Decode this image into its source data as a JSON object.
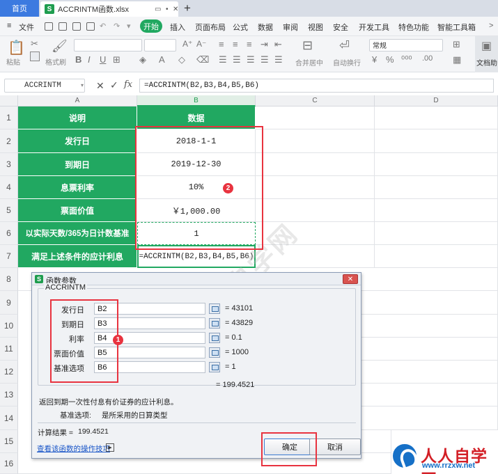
{
  "titlebar": {
    "home_tab": "首页",
    "doc_tab_title": "ACCRINTM函数.xlsx",
    "add_tab": "+"
  },
  "menu": {
    "file": "文件",
    "items": [
      "开始",
      "插入",
      "页面布局",
      "公式",
      "数据",
      "审阅",
      "视图",
      "安全",
      "开发工具",
      "特色功能",
      "智能工具箱"
    ]
  },
  "ribbon": {
    "paste": "粘贴",
    "format_painter": "格式刷",
    "merge_center": "合并居中",
    "auto_wrap": "自动换行",
    "number_format": "常规",
    "doc_helper": "文档助"
  },
  "formula_bar": {
    "name_box": "ACCRINTM",
    "fx": "fx",
    "formula": "=ACCRINTM(B2,B3,B4,B5,B6)"
  },
  "grid": {
    "columns": [
      "A",
      "B",
      "C",
      "D"
    ],
    "rows": [
      "1",
      "2",
      "3",
      "4",
      "5",
      "6",
      "7",
      "8",
      "9",
      "10",
      "11",
      "12",
      "13",
      "14",
      "15",
      "16"
    ],
    "data": [
      {
        "label": "说明",
        "value": "数据"
      },
      {
        "label": "发行日",
        "value": "2018-1-1"
      },
      {
        "label": "到期日",
        "value": "2019-12-30"
      },
      {
        "label": "息票利率",
        "value": "10%"
      },
      {
        "label": "票面价值",
        "value": "￥1,000.00"
      },
      {
        "label": "以实际天数/365为日计数基准",
        "value": "1"
      },
      {
        "label": "满足上述条件的应计利息",
        "value": "=ACCRINTM(B2,B3,B4,B5,B6)"
      }
    ]
  },
  "badges": {
    "one": "1",
    "two": "2"
  },
  "dialog": {
    "title": "函数参数",
    "function_name": "ACCRINTM",
    "args": [
      {
        "label": "发行日",
        "value": "B2",
        "result": "= 43101"
      },
      {
        "label": "到期日",
        "value": "B3",
        "result": "= 43829"
      },
      {
        "label": "利率",
        "value": "B4",
        "result": "= 0.1"
      },
      {
        "label": "票面价值",
        "value": "B5",
        "result": "= 1000"
      },
      {
        "label": "基准选项",
        "value": "B6",
        "result": "= 1"
      }
    ],
    "total": "= 199.4521",
    "description": "返回到期一次性付息有价证券的应计利息。",
    "arg_desc_label": "基准选项:",
    "arg_desc": "是所采用的日算类型",
    "calc_label": "计算结果 =",
    "calc_value": "199.4521",
    "help_link": "查看该函数的操作技巧",
    "ok": "确定",
    "cancel": "取消"
  },
  "watermark": "软件自学网",
  "logo": {
    "text": "人人自学网",
    "url": "www.rrzxw.net"
  }
}
